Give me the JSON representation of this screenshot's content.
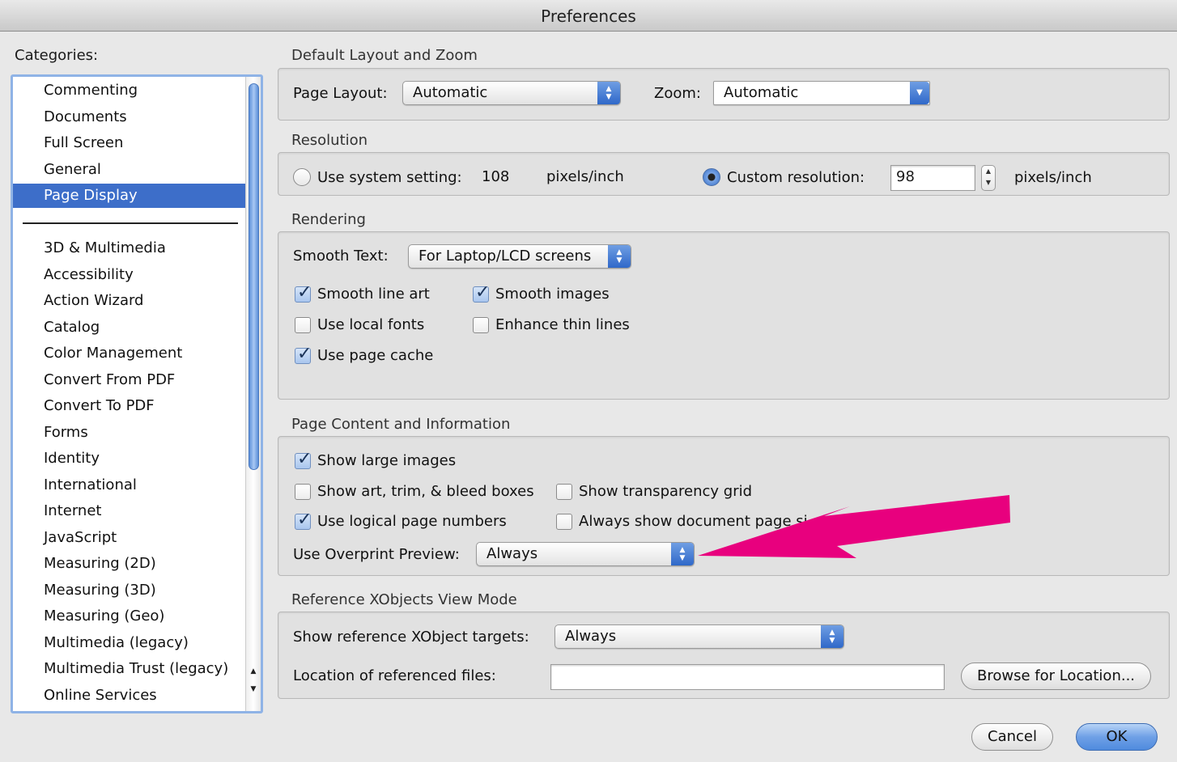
{
  "window": {
    "title": "Preferences"
  },
  "categories": {
    "label": "Categories:",
    "items": [
      "Commenting",
      "Documents",
      "Full Screen",
      "General",
      "Page Display",
      "3D & Multimedia",
      "Accessibility",
      "Action Wizard",
      "Catalog",
      "Color Management",
      "Convert From PDF",
      "Convert To PDF",
      "Forms",
      "Identity",
      "International",
      "Internet",
      "JavaScript",
      "Measuring (2D)",
      "Measuring (3D)",
      "Measuring (Geo)",
      "Multimedia (legacy)",
      "Multimedia Trust (legacy)",
      "Online Services"
    ],
    "selected": "Page Display"
  },
  "layout_zoom": {
    "title": "Default Layout and Zoom",
    "page_layout_label": "Page Layout:",
    "page_layout_value": "Automatic",
    "zoom_label": "Zoom:",
    "zoom_value": "Automatic"
  },
  "resolution": {
    "title": "Resolution",
    "system_label": "Use system setting:",
    "system_value": "108",
    "system_unit": "pixels/inch",
    "custom_label": "Custom resolution:",
    "custom_value": "98",
    "custom_unit": "pixels/inch",
    "selected": "custom"
  },
  "rendering": {
    "title": "Rendering",
    "smooth_text_label": "Smooth Text:",
    "smooth_text_value": "For Laptop/LCD screens",
    "smooth_line_art": {
      "label": "Smooth line art",
      "checked": true
    },
    "smooth_images": {
      "label": "Smooth images",
      "checked": true
    },
    "use_local_fonts": {
      "label": "Use local fonts",
      "checked": false
    },
    "enhance_thin_lines": {
      "label": "Enhance thin lines",
      "checked": false
    },
    "use_page_cache": {
      "label": "Use page cache",
      "checked": true
    }
  },
  "page_content": {
    "title": "Page Content and Information",
    "show_large_images": {
      "label": "Show large images",
      "checked": true
    },
    "show_art_trim_bleed": {
      "label": "Show art, trim, & bleed boxes",
      "checked": false
    },
    "show_transparency_grid": {
      "label": "Show transparency grid",
      "checked": false
    },
    "use_logical_page_numbers": {
      "label": "Use logical page numbers",
      "checked": true
    },
    "always_show_doc_page_size": {
      "label": "Always show document page si",
      "checked": false
    },
    "overprint_label": "Use Overprint Preview:",
    "overprint_value": "Always"
  },
  "xobjects": {
    "title": "Reference XObjects View Mode",
    "targets_label": "Show reference XObject targets:",
    "targets_value": "Always",
    "location_label": "Location of referenced files:",
    "location_value": "",
    "browse_label": "Browse for Location..."
  },
  "buttons": {
    "cancel": "Cancel",
    "ok": "OK"
  },
  "colors": {
    "annotation_arrow": "#e8007e",
    "selection": "#3d6ec9"
  }
}
